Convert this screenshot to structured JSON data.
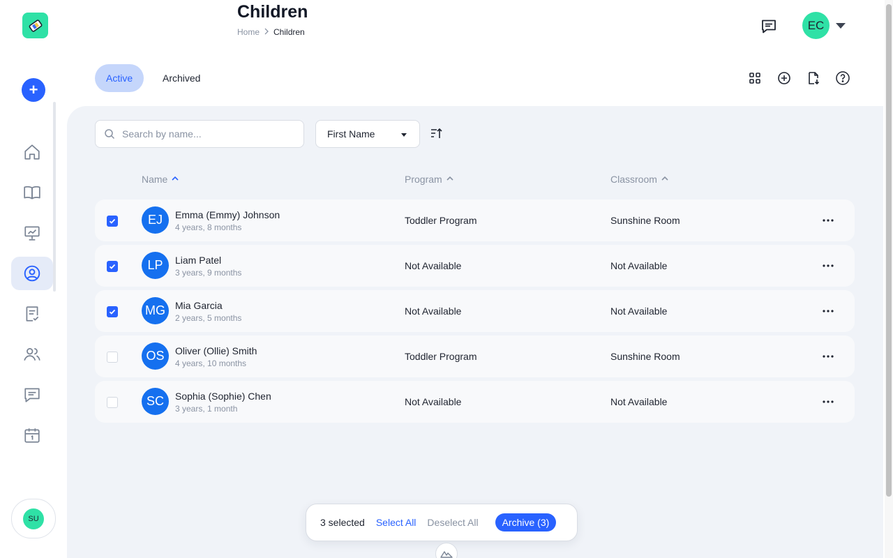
{
  "colors": {
    "accent": "#2962ff",
    "brand_green": "#2fe1a6",
    "avatar_blue": "#1570ef",
    "panel_bg": "#f0f3f8"
  },
  "sidebar": {
    "logo_icon": "app-logo-icon",
    "add_icon": "plus-icon",
    "items": [
      {
        "icon": "home-icon",
        "active": false
      },
      {
        "icon": "book-icon",
        "active": false
      },
      {
        "icon": "presentation-chart-icon",
        "active": false
      },
      {
        "icon": "user-circle-icon",
        "active": true
      },
      {
        "icon": "checklist-icon",
        "active": false
      },
      {
        "icon": "users-icon",
        "active": false
      },
      {
        "icon": "message-icon",
        "active": false
      },
      {
        "icon": "calendar-icon",
        "active": false
      }
    ],
    "user_initials": "SU"
  },
  "header": {
    "title": "Children",
    "breadcrumb_home": "Home",
    "breadcrumb_current": "Children",
    "user_initials": "EC"
  },
  "tabs": [
    {
      "label": "Active",
      "active": true
    },
    {
      "label": "Archived",
      "active": false
    }
  ],
  "toolbar": {
    "icons": [
      "grid-view-icon",
      "add-circle-icon",
      "import-file-icon",
      "help-icon"
    ]
  },
  "filters": {
    "search_placeholder": "Search by name...",
    "sort_field": "First Name"
  },
  "table": {
    "columns": [
      "Name",
      "Program",
      "Classroom"
    ],
    "rows": [
      {
        "initials": "EJ",
        "name": "Emma (Emmy) Johnson",
        "age": "4 years, 8 months",
        "program": "Toddler Program",
        "classroom": "Sunshine Room",
        "checked": true
      },
      {
        "initials": "LP",
        "name": "Liam Patel",
        "age": "3 years, 9 months",
        "program": "Not Available",
        "classroom": "Not Available",
        "checked": true
      },
      {
        "initials": "MG",
        "name": "Mia Garcia",
        "age": "2 years, 5 months",
        "program": "Not Available",
        "classroom": "Not Available",
        "checked": true
      },
      {
        "initials": "OS",
        "name": "Oliver (Ollie) Smith",
        "age": "4 years, 10 months",
        "program": "Toddler Program",
        "classroom": "Sunshine Room",
        "checked": false
      },
      {
        "initials": "SC",
        "name": "Sophia (Sophie) Chen",
        "age": "3 years, 1 month",
        "program": "Not Available",
        "classroom": "Not Available",
        "checked": false
      }
    ]
  },
  "selection_bar": {
    "count_label": "3 selected",
    "select_all": "Select All",
    "deselect_all": "Deselect All",
    "archive_label": "Archive (3)"
  }
}
